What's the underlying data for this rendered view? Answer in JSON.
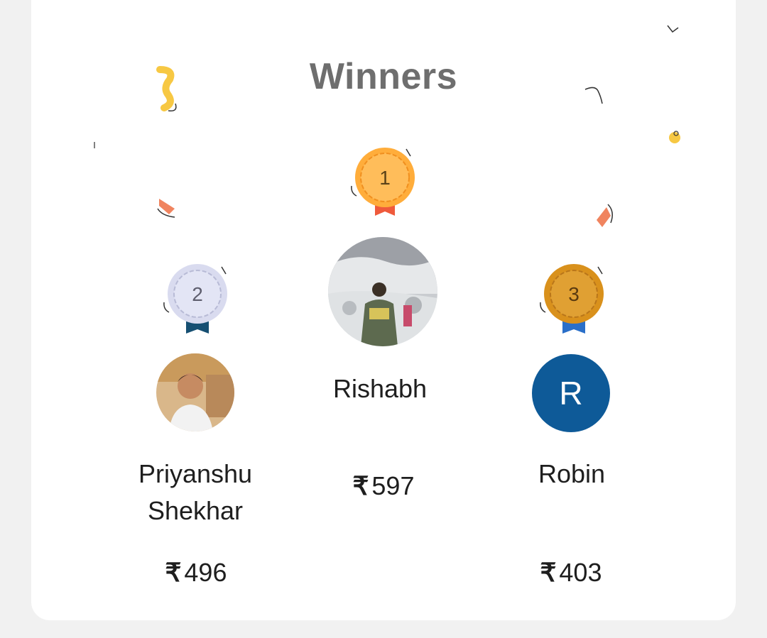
{
  "title": "Winners",
  "currency_symbol": "₹",
  "accent_colors": {
    "gold_medal": "#ffad3b",
    "silver_medal": "#d9dbef",
    "bronze_medal": "#d9911c",
    "avatar_bg": "#0e5a98"
  },
  "winners": [
    {
      "rank": "1",
      "name": "Rishabh",
      "prize": "597",
      "avatar": "photo"
    },
    {
      "rank": "2",
      "name_line1": "Priyanshu",
      "name_line2": "Shekhar",
      "prize": "496",
      "avatar": "photo"
    },
    {
      "rank": "3",
      "name": "Robin",
      "prize": "403",
      "avatar_letter": "R"
    }
  ]
}
